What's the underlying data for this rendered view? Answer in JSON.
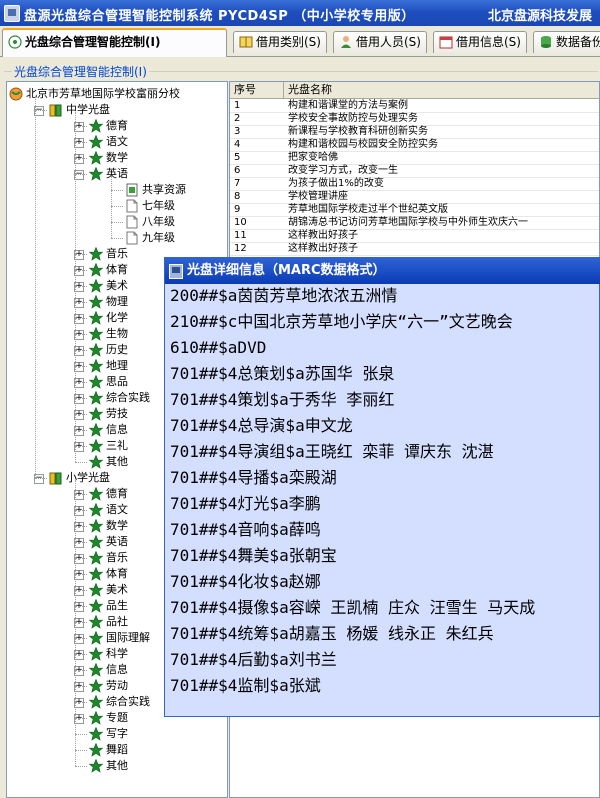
{
  "window": {
    "title": "盘源光盘综合管理智能控制系统 PYCD4SP （中小学校专用版）",
    "company": "北京盘源科技发展"
  },
  "tabs": [
    {
      "label": "光盘综合管理智能控制(I)",
      "icon": "disc-icon",
      "active": true
    },
    {
      "label": "借用类别(S)",
      "icon": "book-icon",
      "active": false
    },
    {
      "label": "借用人员(S)",
      "icon": "person-icon",
      "active": false
    },
    {
      "label": "借用信息(S)",
      "icon": "calendar-icon",
      "active": false
    },
    {
      "label": "数据备份",
      "icon": "database-icon",
      "active": false
    }
  ],
  "group": {
    "title": "光盘综合管理智能控制(I)"
  },
  "tree": {
    "root": "北京市芳草地国际学校富丽分校",
    "middle": {
      "label": "中学光盘",
      "items": [
        "德育",
        "语文",
        "数学",
        "英语"
      ],
      "english_children": [
        "共享资源",
        "七年级",
        "八年级",
        "九年级"
      ],
      "more_items": [
        "音乐",
        "体育",
        "美术",
        "物理",
        "化学",
        "生物",
        "历史",
        "地理",
        "思品",
        "综合实践",
        "劳技",
        "信息",
        "三礼",
        "其他"
      ]
    },
    "primary": {
      "label": "小学光盘",
      "items": [
        "德育",
        "语文",
        "数学",
        "英语",
        "音乐",
        "体育",
        "美术",
        "品生",
        "品社",
        "国际理解",
        "科学",
        "信息",
        "劳动",
        "综合实践",
        "专题",
        "写字",
        "舞蹈",
        "其他"
      ]
    }
  },
  "grid": {
    "columns": [
      "序号",
      "光盘名称"
    ],
    "rows": [
      [
        "1",
        "构建和谐课堂的方法与案例"
      ],
      [
        "2",
        "学校安全事故防控与处理实务"
      ],
      [
        "3",
        "新课程与学校教育科研创新实务"
      ],
      [
        "4",
        "构建和谐校园与校园安全防控实务"
      ],
      [
        "5",
        "把家变哈佛"
      ],
      [
        "6",
        "改变学习方式，改变一生"
      ],
      [
        "7",
        "为孩子做出1%的改变"
      ],
      [
        "8",
        "学校管理讲座"
      ],
      [
        "9",
        "芳草地国际学校走过半个世纪英文版"
      ],
      [
        "10",
        "胡锦涛总书记访问芳草地国际学校与中外师生欢庆六一"
      ],
      [
        "11",
        "这样教出好孩子"
      ],
      [
        "12",
        "这样教出好孩子"
      ]
    ]
  },
  "dialog": {
    "title": "光盘详细信息（MARC数据格式）",
    "lines": [
      "200##$a茵茵芳草地浓浓五洲情",
      "210##$c中国北京芳草地小学庆“六一”文艺晚会",
      "610##$aDVD",
      "701##$4总策划$a苏国华 张泉",
      "701##$4策划$a于秀华 李丽红",
      "701##$4总导演$a申文龙",
      "701##$4导演组$a王晓红 栾菲 谭庆东 沈湛",
      "701##$4导播$a栾殿湖",
      "701##$4灯光$a李鹏",
      "701##$4音响$a薛鸣",
      "701##$4舞美$a张朝宝",
      "701##$4化妆$a赵娜",
      "701##$4摄像$a容嵘 王凯楠 庄众 汪雪生 马天成",
      "701##$4统筹$a胡嘉玉 杨媛 线永正 朱红兵",
      "701##$4后勤$a刘书兰",
      "701##$4监制$a张斌"
    ]
  },
  "colors": {
    "titlebar": "#1e4fbf",
    "dialog_bg": "#d4dfff",
    "group_title": "#0046d5",
    "star": "#1a8a2a"
  }
}
